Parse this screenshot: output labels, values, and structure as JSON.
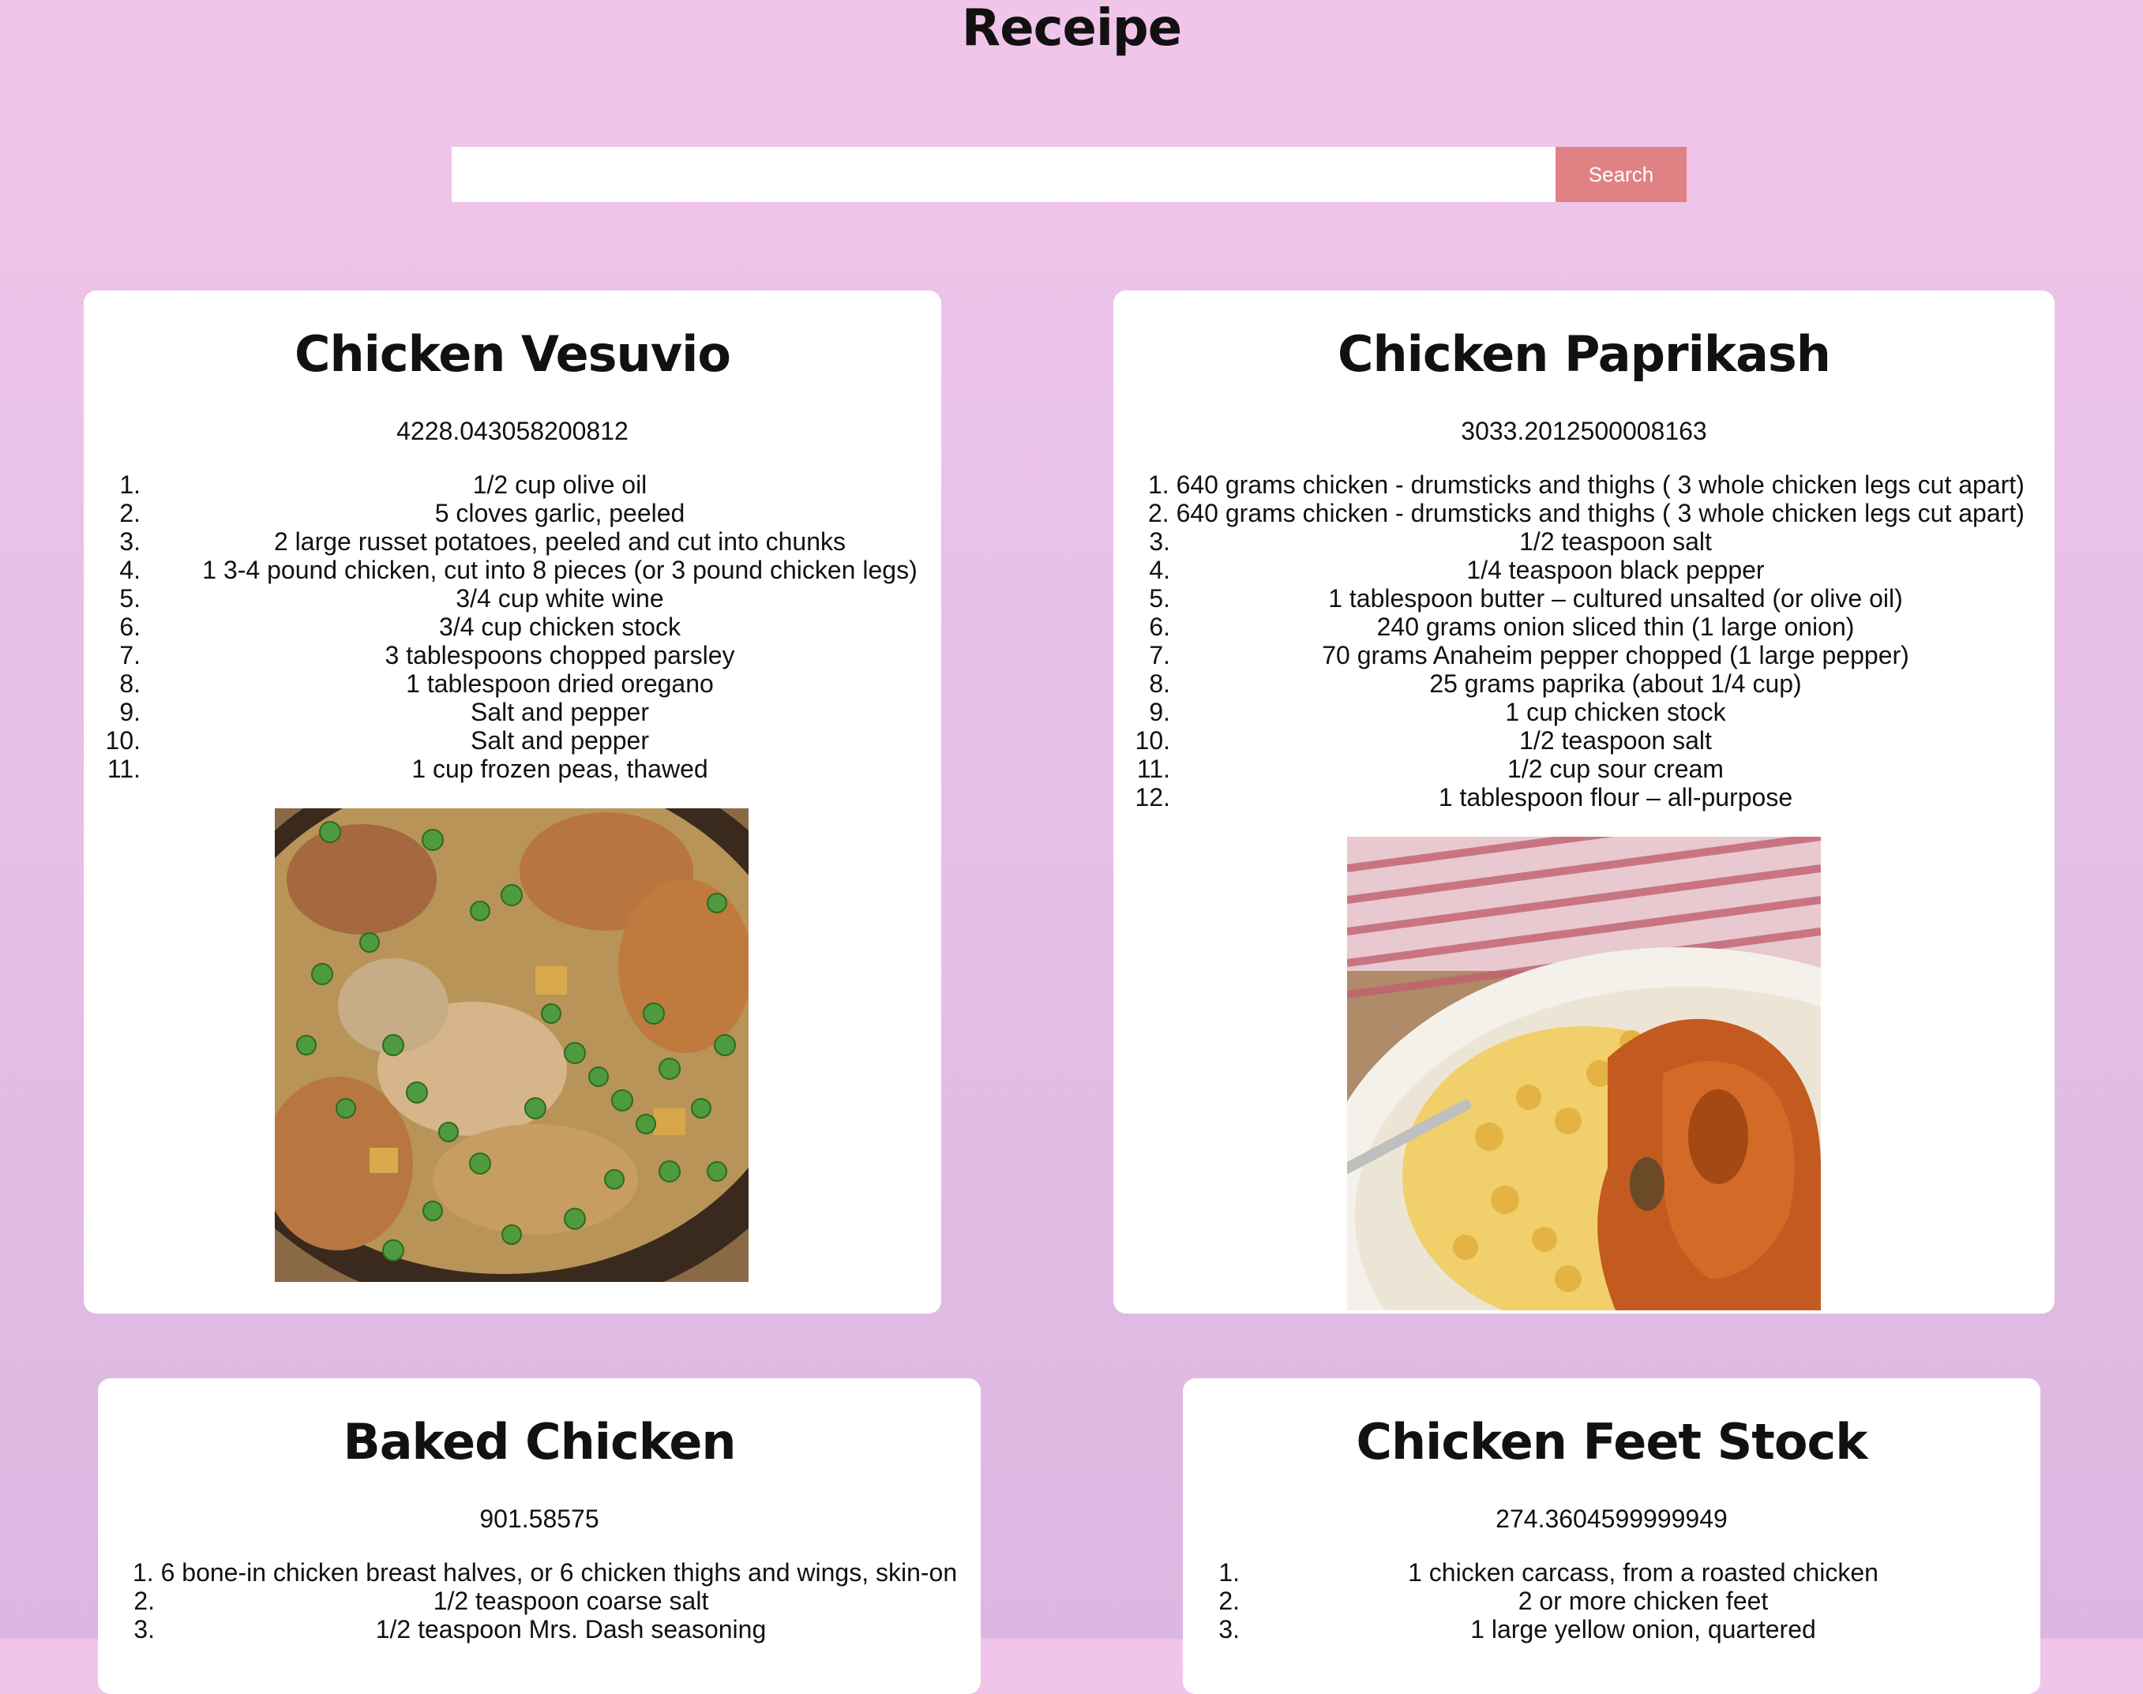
{
  "app": {
    "title": "Receipe"
  },
  "search": {
    "placeholder": "",
    "value": "",
    "button_label": "Search"
  },
  "recipes": [
    {
      "title": "Chicken Vesuvio",
      "calories": "4228.043058200812",
      "ingredients": [
        "1/2 cup olive oil",
        "5 cloves garlic, peeled",
        "2 large russet potatoes, peeled and cut into chunks",
        "1 3-4 pound chicken, cut into 8 pieces (or 3 pound chicken legs)",
        "3/4 cup white wine",
        "3/4 cup chicken stock",
        "3 tablespoons chopped parsley",
        "1 tablespoon dried oregano",
        "Salt and pepper",
        "Salt and pepper",
        "1 cup frozen peas, thawed"
      ],
      "image": "chicken-vesuvio-photo"
    },
    {
      "title": "Chicken Paprikash",
      "calories": "3033.2012500008163",
      "ingredients": [
        "640 grams chicken - drumsticks and thighs ( 3 whole chicken legs cut apart)",
        "640 grams chicken - drumsticks and thighs ( 3 whole chicken legs cut apart)",
        "1/2 teaspoon salt",
        "1/4 teaspoon black pepper",
        "1 tablespoon butter – cultured unsalted (or olive oil)",
        "240 grams onion sliced thin (1 large onion)",
        "70 grams Anaheim pepper chopped (1 large pepper)",
        "25 grams paprika (about 1/4 cup)",
        "1 cup chicken stock",
        "1/2 teaspoon salt",
        "1/2 cup sour cream",
        "1 tablespoon flour – all-purpose"
      ],
      "image": "chicken-paprikash-photo"
    },
    {
      "title": "Baked Chicken",
      "calories": "901.58575",
      "ingredients": [
        "6 bone-in chicken breast halves, or 6 chicken thighs and wings, skin-on",
        "1/2 teaspoon coarse salt",
        "1/2 teaspoon Mrs. Dash seasoning"
      ],
      "image": "baked-chicken-photo"
    },
    {
      "title": "Chicken Feet Stock",
      "calories": "274.3604599999949",
      "ingredients": [
        "1 chicken carcass, from a roasted chicken",
        "2 or more chicken feet",
        "1 large yellow onion, quartered"
      ],
      "image": "chicken-feet-stock-photo"
    }
  ],
  "colors": {
    "accent": "#e08283",
    "card": "#ffffff",
    "background_top": "#f0c5e9",
    "background_bottom": "#dbb7e1"
  }
}
